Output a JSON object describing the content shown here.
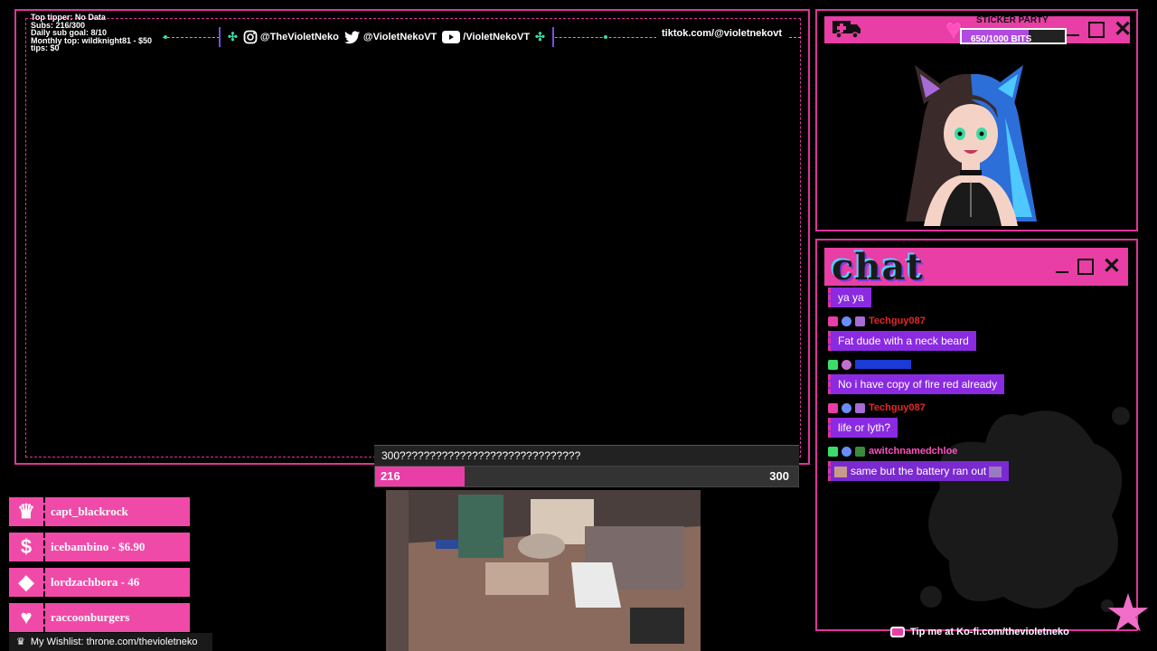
{
  "stats": {
    "top_tipper": "Top tipper: No Data",
    "subs": "Subs: 216/300",
    "daily_sub_goal": "Daily sub goal: 8/10",
    "monthly_top": "Monthly top: wildknight81 - $50",
    "tips": "tips: $0"
  },
  "socials": {
    "instagram": "@TheVioletNeko",
    "twitter": "@VioletNekoVT",
    "youtube": "/VioletNekoVT",
    "tiktok": "tiktok.com/@violetnekovt"
  },
  "sticker_party": {
    "title": "STICKER PARTY",
    "progress_text": "650/1000 BITS",
    "current": 650,
    "goal": 1000
  },
  "chat": {
    "title": "chat",
    "messages": [
      {
        "user": "",
        "text": "ya ya",
        "user_color": "#ff3b3b"
      },
      {
        "user": "Techguy087",
        "text": "Fat dude with a neck beard",
        "user_color": "#e5262b"
      },
      {
        "user": "",
        "text": "No i have copy of fire red already",
        "user_color": "#1a3bd6"
      },
      {
        "user": "Techguy087",
        "text": "life or lyth?",
        "user_color": "#e5262b"
      },
      {
        "user": "awitchnamedchloe",
        "text": "same but the battery ran out",
        "user_color": "#ff4fc0"
      }
    ]
  },
  "subgoal": {
    "label": "300??????????????????????????????",
    "current": 216,
    "goal": 300,
    "current_text": "216",
    "goal_text": "300"
  },
  "alerts": [
    {
      "icon": "crown-icon",
      "glyph": "♛",
      "text": "capt_blackrock"
    },
    {
      "icon": "dollar-icon",
      "glyph": "$",
      "text": "icebambino - $6.90"
    },
    {
      "icon": "diamond-icon",
      "glyph": "◆",
      "text": "lordzachbora - 46"
    },
    {
      "icon": "heart-icon",
      "glyph": "♥",
      "text": "raccoonburgers"
    }
  ],
  "wishlist": "My Wishlist: throne.com/thevioletneko",
  "kofi": "Tip me at Ko-fi.com/thevioletneko",
  "colors": {
    "accent": "#e83ea5",
    "bubble": "#8a2be2",
    "social": "#3ddca0"
  }
}
